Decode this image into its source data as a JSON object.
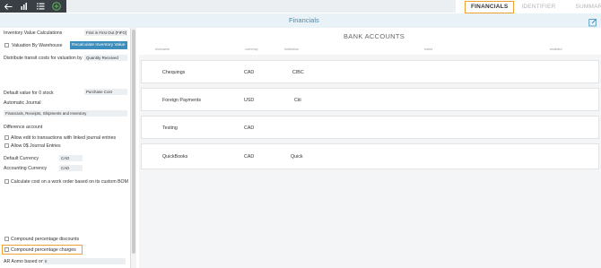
{
  "toolbar": {
    "icons": [
      "back-arrow-icon",
      "bar-chart-icon",
      "list-icon",
      "add-circle-icon"
    ]
  },
  "tabs": {
    "financials": "FINANCIALS",
    "identifier": "IDENTIFIER",
    "summary": "SUMMARY",
    "active": "FINANCIALS",
    "accent_color": "#f0a030"
  },
  "titlebar": {
    "title": "Financials",
    "title_color": "#3c8dbc"
  },
  "settings": {
    "inventory_value_calc_label": "Inventory Value Calculations",
    "inventory_value_calc_value": "First in First Out (FIFO)",
    "valuation_by_warehouse_label": "Valuation By Warehouse",
    "recalc_button": "Recalculate Inventory Value",
    "distribute_transit_label": "Distribute transit costs for valuation by",
    "distribute_transit_value": "Quantity Received",
    "default_value_label": "Default value for 0 stock",
    "default_value_value": "Purchase Cost",
    "automatic_journal_label": "Automatic Journal",
    "automatic_journal_value": "Financials, Receipts, Shipments and Inventory",
    "difference_account_label": "Difference account",
    "allow_edit_label": "Allow edit to transactions with linked journal entries",
    "allow_0s_label": "Allow 0$ Journal Entries",
    "default_currency_label": "Default Currency",
    "default_currency_value": "CAD",
    "accounting_currency_label": "Accounting Currency",
    "accounting_currency_value": "CAD",
    "calculate_cost_label": "Calculate cost on a work order based on its custom BOM",
    "compound_discounts_label": "Compound percentage discounts",
    "compound_charges_label": "Compound percentage charges",
    "alr_aomo_label": "AR Aomo based on",
    "alr_aomo_value": "II"
  },
  "bank": {
    "title": "BANK ACCOUNTS",
    "columns": [
      "nickname",
      "currency",
      "institution",
      "notes",
      "enabled"
    ],
    "rows": [
      {
        "nickname": "Chequings",
        "currency": "CAD",
        "institution": "CIBC"
      },
      {
        "nickname": "Foreign Payments",
        "currency": "USD",
        "institution": "Citi"
      },
      {
        "nickname": "Testing",
        "currency": "CAD",
        "institution": ""
      },
      {
        "nickname": "QuickBooks",
        "currency": "CAD",
        "institution": "Quick"
      }
    ]
  }
}
